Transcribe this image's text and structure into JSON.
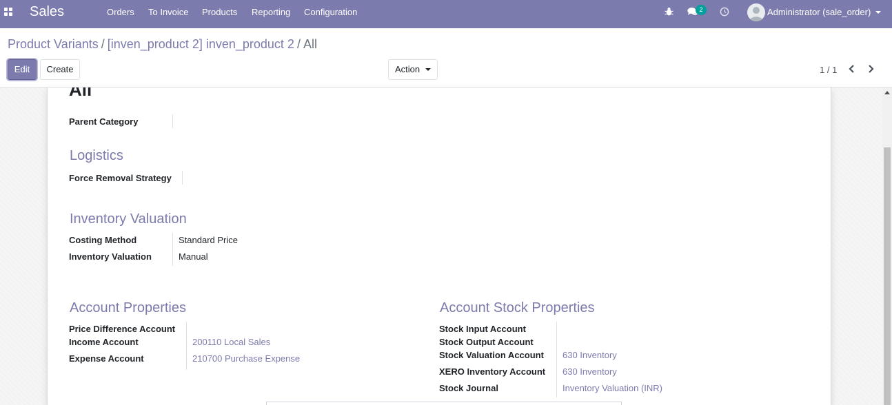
{
  "navbar": {
    "app_name": "Sales",
    "menus": [
      "Orders",
      "To Invoice",
      "Products",
      "Reporting",
      "Configuration"
    ],
    "messages_count": "2",
    "user": "Administrator (sale_order)",
    "icons": [
      "apps-icon",
      "bug-icon",
      "chat-icon",
      "clock-icon",
      "avatar-icon",
      "caret-down-icon"
    ]
  },
  "breadcrumb": {
    "items": [
      "Product Variants",
      "[inven_product 2] inven_product 2",
      "All"
    ]
  },
  "buttons": {
    "edit": "Edit",
    "create": "Create",
    "action": "Action"
  },
  "pager": {
    "value": "1 / 1"
  },
  "form": {
    "title": "All",
    "parent_category_label": "Parent Category",
    "logistics": {
      "heading": "Logistics",
      "force_removal_label": "Force Removal Strategy"
    },
    "inventory_valuation": {
      "heading": "Inventory Valuation",
      "costing_method_label": "Costing Method",
      "costing_method_value": "Standard Price",
      "valuation_label": "Inventory Valuation",
      "valuation_value": "Manual"
    },
    "account_properties": {
      "heading": "Account Properties",
      "price_difference_label": "Price Difference Account",
      "income_label": "Income Account",
      "income_value": "200110 Local Sales",
      "expense_label": "Expense Account",
      "expense_value": "210700 Purchase Expense"
    },
    "account_stock_properties": {
      "heading": "Account Stock Properties",
      "stock_input_label": "Stock Input Account",
      "stock_output_label": "Stock Output Account",
      "stock_valuation_label": "Stock Valuation Account",
      "stock_valuation_value": "630 Inventory",
      "xero_inventory_label": "XERO Inventory Account",
      "xero_inventory_value": "630 Inventory",
      "stock_journal_label": "Stock Journal",
      "stock_journal_value": "Inventory Valuation (INR)"
    }
  },
  "colors": {
    "brand": "#7c7bad",
    "badge": "#00a09d"
  }
}
